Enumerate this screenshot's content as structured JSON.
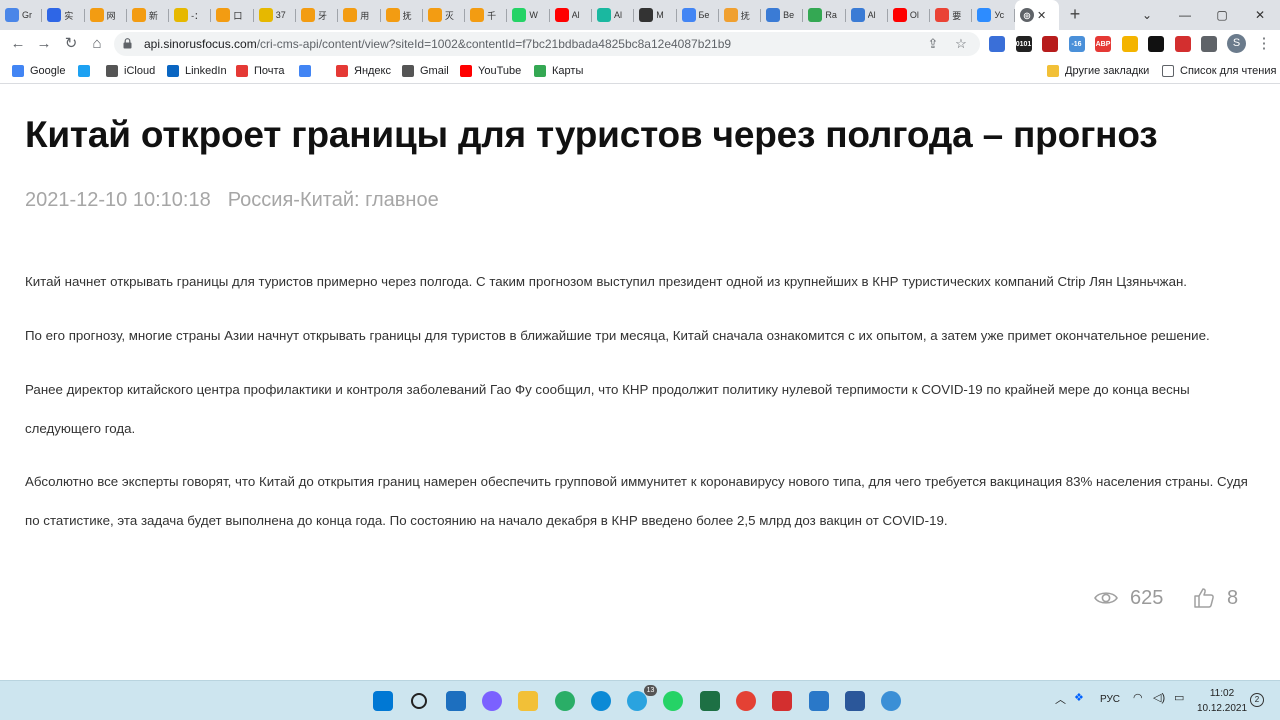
{
  "browser": {
    "tabs": [
      {
        "label": "Gr",
        "icon": "google-docs-icon",
        "color": "#4a86e8"
      },
      {
        "label": "实",
        "icon": "baidu-icon",
        "color": "#2e66e6"
      },
      {
        "label": "网",
        "icon": "tab-icon",
        "color": "#f39c12"
      },
      {
        "label": "新",
        "icon": "tab-icon",
        "color": "#f39c12"
      },
      {
        "label": "-：",
        "icon": "tab-icon",
        "color": "#e6b800"
      },
      {
        "label": "口",
        "icon": "tab-icon",
        "color": "#f39c12"
      },
      {
        "label": "37",
        "icon": "tab-icon",
        "color": "#e6b800"
      },
      {
        "label": "牙",
        "icon": "tab-icon",
        "color": "#f39c12"
      },
      {
        "label": "用",
        "icon": "tab-icon",
        "color": "#f39c12"
      },
      {
        "label": "抚",
        "icon": "tab-icon",
        "color": "#f39c12"
      },
      {
        "label": "灭",
        "icon": "tab-icon",
        "color": "#f39c12"
      },
      {
        "label": "千",
        "icon": "tab-icon",
        "color": "#f39c12"
      },
      {
        "label": "W",
        "icon": "whatsapp-icon",
        "color": "#25d366"
      },
      {
        "label": "Al",
        "icon": "youtube-icon",
        "color": "#ff0000"
      },
      {
        "label": "Al",
        "icon": "tab-icon",
        "color": "#1ab8a0"
      },
      {
        "label": "M",
        "icon": "vector-icon",
        "color": "#333333"
      },
      {
        "label": "Бе",
        "icon": "google-icon",
        "color": "#4285f4"
      },
      {
        "label": "抚",
        "icon": "tab-icon",
        "color": "#f0a030"
      },
      {
        "label": "Ве",
        "icon": "tab-icon",
        "color": "#3a7bd5"
      },
      {
        "label": "Ra",
        "icon": "dot-icon",
        "color": "#34a853"
      },
      {
        "label": "Al",
        "icon": "tab-icon",
        "color": "#3a7bd5"
      },
      {
        "label": "Ol",
        "icon": "youtube-icon",
        "color": "#ff0000"
      },
      {
        "label": "要",
        "icon": "maps-pin-icon",
        "color": "#ea4335"
      },
      {
        "label": "Ус",
        "icon": "zoom-icon",
        "color": "#2d8cff"
      }
    ],
    "active_tab": {
      "label": "",
      "icon": "globe-icon",
      "close": "✕"
    },
    "new_tab": "+",
    "url_host": "api.sinorusfocus.com",
    "url_path": "/cri-cms-api/content/view?siteId=1002&contentId=f7bc21bdbada4825bc8a12e4087b21b9",
    "profile_initial": "S",
    "extensions": [
      {
        "name": "extension-grid-icon",
        "color": "#3a6fd8",
        "text": ""
      },
      {
        "name": "extension-binary-icon",
        "color": "#222222",
        "text": "0101"
      },
      {
        "name": "extension-shield-icon",
        "color": "#b71c1c",
        "text": ""
      },
      {
        "name": "extension-weather-icon",
        "color": "#4a90d9",
        "text": "-16"
      },
      {
        "name": "extension-adblock-icon",
        "color": "#e53935",
        "text": "ABP"
      },
      {
        "name": "extension-yellow-icon",
        "color": "#f4b400",
        "text": ""
      },
      {
        "name": "extension-black-icon",
        "color": "#111111",
        "text": ""
      },
      {
        "name": "extension-pdf-icon",
        "color": "#d32f2f",
        "text": ""
      },
      {
        "name": "extensions-puzzle-icon",
        "color": "#5f6368",
        "text": ""
      }
    ]
  },
  "bookmarks": {
    "items": [
      {
        "label": "Google",
        "icon": "google-icon",
        "color": "#4285f4"
      },
      {
        "label": "",
        "icon": "twitter-icon",
        "color": "#1da1f2"
      },
      {
        "label": "iCloud",
        "icon": "apple-icon",
        "color": "#555555"
      },
      {
        "label": "LinkedIn",
        "icon": "linkedin-icon",
        "color": "#0a66c2"
      },
      {
        "label": "Почта",
        "icon": "mail-icon",
        "color": "#e53935"
      },
      {
        "label": "",
        "icon": "translate-icon",
        "color": "#4285f4"
      },
      {
        "label": "Яндекс",
        "icon": "yandex-icon",
        "color": "#e53935"
      },
      {
        "label": "Gmail",
        "icon": "gmail-icon",
        "color": "#555555"
      },
      {
        "label": "YouTube",
        "icon": "youtube-icon",
        "color": "#ff0000"
      },
      {
        "label": "Карты",
        "icon": "maps-pin-icon",
        "color": "#34a853"
      }
    ],
    "other": "Другие закладки",
    "reading_list": "Список для чтения"
  },
  "article": {
    "title": "Китай откроет границы для туристов через полгода – прогноз",
    "date": "2021-12-10 10:10:18",
    "category": "Россия-Китай: главное",
    "paragraphs": [
      "Китай начнет открывать границы для туристов примерно через полгода. С таким прогнозом выступил президент одной из крупнейших в КНР туристических компаний Ctrip Лян Цзяньчжан.",
      "По его прогнозу, многие страны Азии начнут открывать границы для туристов в ближайшие три месяца, Китай сначала ознакомится с их опытом, а затем уже примет окончательное решение.",
      "Ранее директор китайского центра профилактики и контроля заболеваний Гао Фу сообщил, что КНР продолжит политику нулевой терпимости к COVID-19 по крайней мере до конца весны следующего года.",
      "Абсолютно все эксперты говорят, что Китай до открытия границ намерен обеспечить групповой иммунитет к коронавирусу нового типа, для чего требуется вакцинация 83% населения страны. Судя по статистике, эта задача будет выполнена до конца года. По состоянию на начало декабря в КНР введено более 2,5 млрд доз вакцин от COVID-19."
    ],
    "views": "625",
    "likes": "8"
  },
  "taskbar": {
    "apps": [
      {
        "name": "windows-start-icon",
        "color": "#0078d4"
      },
      {
        "name": "search-icon",
        "color": "#222222"
      },
      {
        "name": "task-view-icon",
        "color": "#1d6fbf"
      },
      {
        "name": "chat-icon",
        "color": "#7b61ff"
      },
      {
        "name": "file-explorer-icon",
        "color": "#f2c037"
      },
      {
        "name": "wechat-icon",
        "color": "#2aae67"
      },
      {
        "name": "edge-icon",
        "color": "#0c8ad6"
      },
      {
        "name": "telegram-icon",
        "color": "#2aa3df"
      },
      {
        "name": "whatsapp-icon",
        "color": "#25d366"
      },
      {
        "name": "excel-icon",
        "color": "#1d7044"
      },
      {
        "name": "chrome-icon",
        "color": "#e44134"
      },
      {
        "name": "acrobat-icon",
        "color": "#d32f2f"
      },
      {
        "name": "app-icon",
        "color": "#2a78c8"
      },
      {
        "name": "word-icon",
        "color": "#2b579a"
      },
      {
        "name": "globe-app-icon",
        "color": "#3b8fd6"
      }
    ],
    "telegram_badge": "13",
    "language": "РУС",
    "time": "11:02",
    "date": "10.12.2021",
    "notifications": "2"
  }
}
